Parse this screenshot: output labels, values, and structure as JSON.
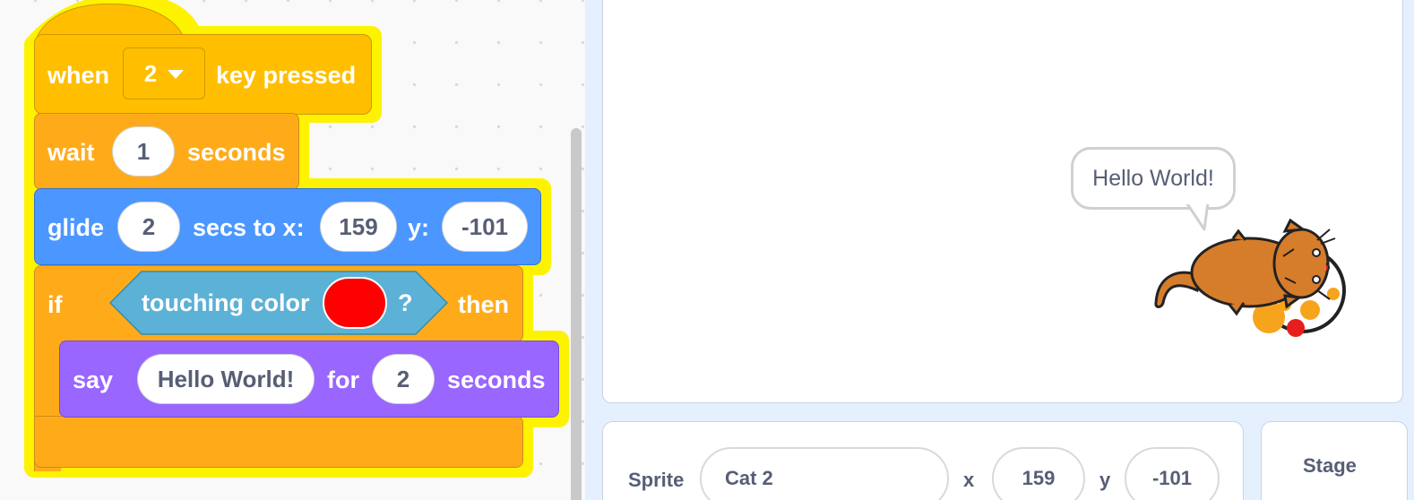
{
  "script": {
    "hat": {
      "when": "when",
      "key": "2",
      "key_pressed": "key pressed"
    },
    "wait": {
      "label": "wait",
      "value": "1",
      "unit": "seconds"
    },
    "glide": {
      "label": "glide",
      "secs": "2",
      "secs_to_x": "secs to x:",
      "x": "159",
      "y_label": "y:",
      "y": "-101"
    },
    "if_block": {
      "if": "if",
      "then": "then",
      "touching": "touching color",
      "question": "?",
      "color": "#ff0000"
    },
    "say": {
      "label": "say",
      "message": "Hello World!",
      "for": "for",
      "secs": "2",
      "unit": "seconds"
    }
  },
  "stage": {
    "speech": "Hello World!"
  },
  "sprite_info": {
    "sprite_label": "Sprite",
    "name": "Cat 2",
    "x_label": "x",
    "x": "159",
    "y_label": "y",
    "y": "-101"
  },
  "stage_panel": {
    "label": "Stage"
  },
  "colors": {
    "events": "#ffbf00",
    "control": "#ffab19",
    "motion": "#4c97ff",
    "sensing": "#5cb1d6",
    "looks": "#9966ff",
    "highlight": "#fdf300"
  },
  "icons": [
    "dropdown-caret-icon",
    "cat-sprite-icon",
    "speech-bubble-icon"
  ]
}
